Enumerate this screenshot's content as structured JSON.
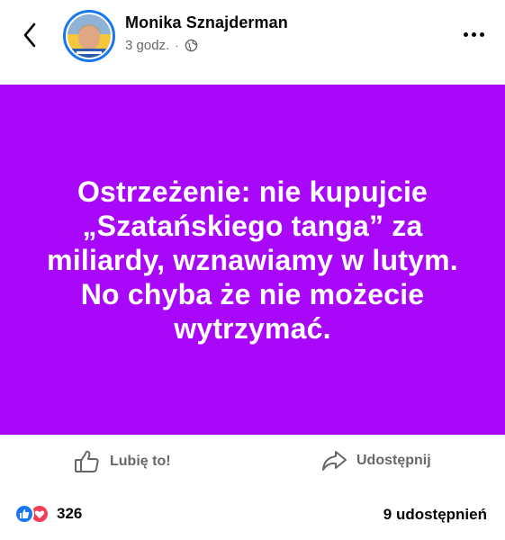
{
  "header": {
    "author": "Monika Sznajderman",
    "time": "3 godz.",
    "separator": "·",
    "back_icon": "chevron-left-icon",
    "privacy_icon": "globe-icon",
    "more_icon": "more-dots-icon"
  },
  "post": {
    "background_color": "#a807fa",
    "text": "Ostrzeżenie: nie kupujcie „Szatańskiego tanga” za miliardy, wznawiamy w lutym. No chyba że nie możecie wytrzymać."
  },
  "actions": {
    "like_label": "Lubię to!",
    "share_label": "Udostępnij"
  },
  "stats": {
    "reaction_count": "326",
    "shares_label": "9 udostępnień"
  },
  "colors": {
    "accent": "#1877f2",
    "love": "#f33e58",
    "secondary_text": "#65676b"
  }
}
